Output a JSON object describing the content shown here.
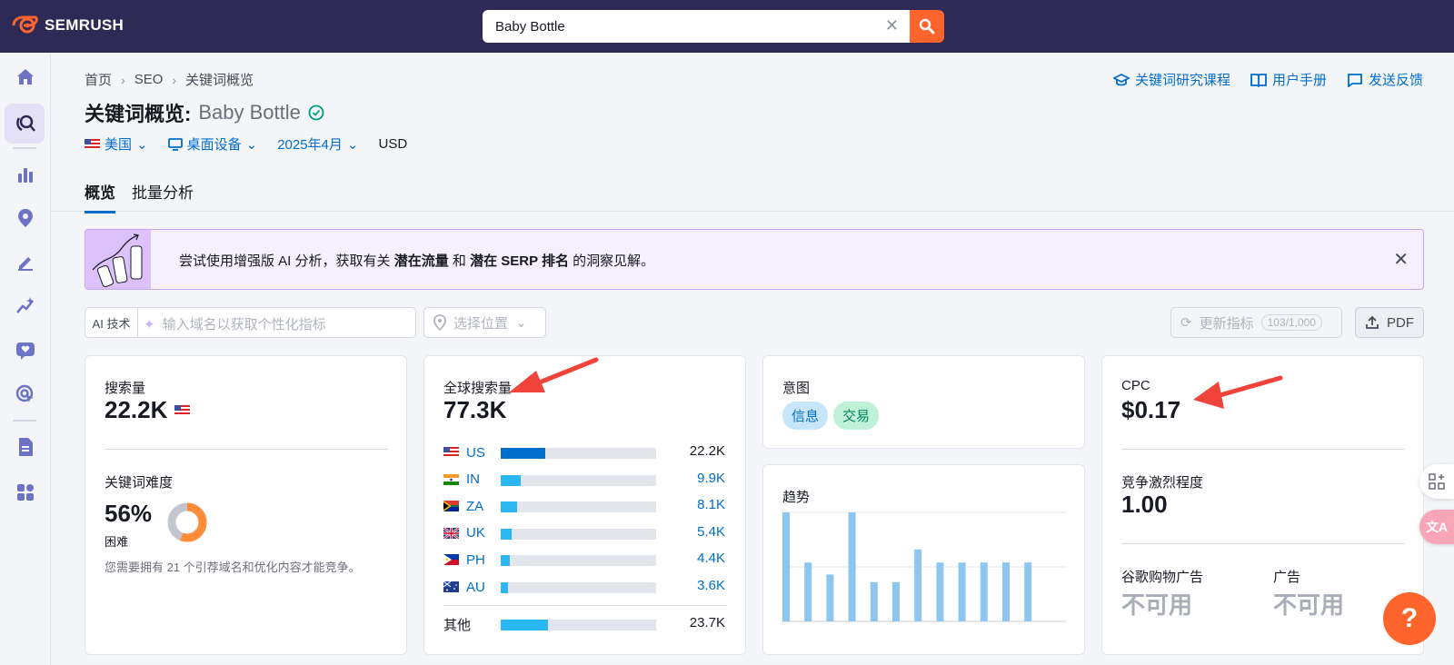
{
  "app": {
    "brand": "SEMRUSH",
    "brand_color": "#ff642d",
    "header_color": "#2e2a55"
  },
  "search": {
    "value": "Baby Bottle"
  },
  "breadcrumb": {
    "home": "首页",
    "seo": "SEO",
    "current": "关键词概览"
  },
  "top_links": {
    "course": "关键词研究课程",
    "manual": "用户手册",
    "feedback": "发送反馈"
  },
  "title": {
    "prefix": "关键词概览:",
    "keyword": "Baby Bottle"
  },
  "filters": {
    "country": "美国",
    "device": "桌面设备",
    "date": "2025年4月",
    "currency": "USD"
  },
  "tabs": {
    "overview": "概览",
    "bulk": "批量分析"
  },
  "banner": {
    "text_1": "尝试使用增强版 AI 分析，获取有关",
    "bold_1": "潜在流量",
    "text_2": "和",
    "bold_2": "潜在 SERP 排名",
    "text_3": "的洞察见解。"
  },
  "ai_row": {
    "tag": "AI 技术",
    "domain_placeholder": "输入域名以获取个性化指标",
    "location_placeholder": "选择位置",
    "update_label": "更新指标",
    "update_count": "103/1,000",
    "pdf_label": "PDF"
  },
  "volume_card": {
    "label": "搜索量",
    "value": "22.2K",
    "kd_label": "关键词难度",
    "kd_value": "56%",
    "kd_percent": 56,
    "kd_level": "困难",
    "kd_note": "您需要拥有 21 个引荐域名和优化内容才能竞争。"
  },
  "global_card": {
    "label": "全球搜索量",
    "value": "77.3K",
    "countries": [
      {
        "code": "US",
        "value": "22.2K",
        "share": 0.287
      },
      {
        "code": "IN",
        "value": "9.9K",
        "share": 0.128
      },
      {
        "code": "ZA",
        "value": "8.1K",
        "share": 0.105
      },
      {
        "code": "UK",
        "value": "5.4K",
        "share": 0.07
      },
      {
        "code": "PH",
        "value": "4.4K",
        "share": 0.057
      },
      {
        "code": "AU",
        "value": "3.6K",
        "share": 0.047
      }
    ],
    "other_label": "其他",
    "other_value": "23.7K",
    "other_share": 0.307
  },
  "intent_card": {
    "label": "意图",
    "chips": [
      "信息",
      "交易"
    ]
  },
  "trend_card": {
    "label": "趋势",
    "chart_data": {
      "type": "bar",
      "values": [
        100,
        54,
        43,
        100,
        36,
        36,
        66,
        54,
        54,
        54,
        54,
        54
      ]
    }
  },
  "cpc_card": {
    "label": "CPC",
    "value": "$0.17",
    "comp_label": "竞争激烈程度",
    "comp_value": "1.00",
    "shopping_label": "谷歌购物广告",
    "shopping_value": "不可用",
    "ads_label": "广告",
    "ads_value": "不可用"
  },
  "help": {
    "label": "?"
  }
}
